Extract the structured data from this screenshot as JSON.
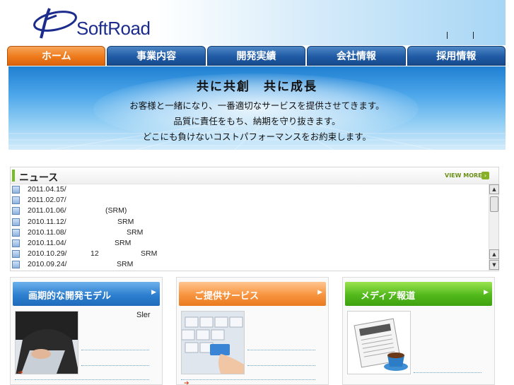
{
  "header": {
    "logo_text": "SoftRoad"
  },
  "nav": {
    "tabs": [
      "ホーム",
      "事業内容",
      "開発実績",
      "会社情報",
      "採用情報"
    ],
    "active_index": 0
  },
  "banner": {
    "title": "共に共創　共に成長",
    "lines": [
      "お客様と一緒になり、一番適切なサービスを提供させてきます。",
      "品質に責任をもち、納期を守り抜きます。",
      "どこにも負けないコストパフォーマンスをお約束します。"
    ]
  },
  "news": {
    "title": "ニュース",
    "view_more": "VIEW MORE",
    "items": [
      {
        "date": "2011.04.15/",
        "text": ""
      },
      {
        "date": "2011.02.07/",
        "text": ""
      },
      {
        "date": "2011.01.06/",
        "text": "(SRM)"
      },
      {
        "date": "2010.11.12/",
        "text": "SRM"
      },
      {
        "date": "2010.11.08/",
        "text": "SRM"
      },
      {
        "date": "2010.11.04/",
        "text": "SRM"
      },
      {
        "date": "2010.10.29/",
        "text": "12",
        "text2": "SRM"
      },
      {
        "date": "2010.09.24/",
        "text": "SRM"
      }
    ]
  },
  "boxes": [
    {
      "title": "画期的な開発モデル",
      "caption": "Sler",
      "color": "#2d7fcf"
    },
    {
      "title": "ご提供サービス",
      "caption": "",
      "color": "#f7943f"
    },
    {
      "title": "メディア報道",
      "caption": "",
      "color": "#52b91c"
    }
  ],
  "icons": [
    "news-item-icon",
    "view-more-arrow-icon",
    "box-arrow-icon"
  ]
}
